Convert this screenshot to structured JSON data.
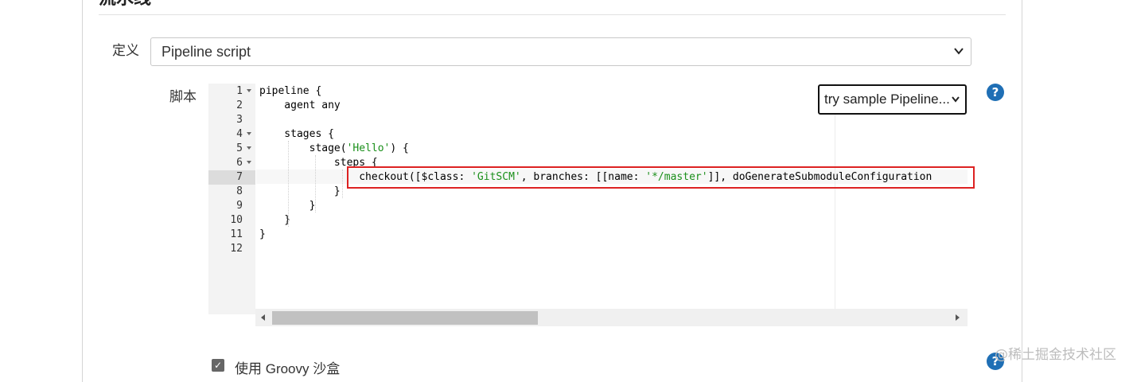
{
  "section": {
    "title": "流水线"
  },
  "definition": {
    "label": "定义",
    "selected": "Pipeline script"
  },
  "script": {
    "label": "脚本",
    "sample_select": "try sample Pipeline...",
    "line_numbers": [
      "1",
      "2",
      "3",
      "4",
      "5",
      "6",
      "7",
      "8",
      "9",
      "10",
      "11",
      "12"
    ],
    "lines": [
      [
        "pipeline {"
      ],
      [
        "    agent any"
      ],
      [
        ""
      ],
      [
        "    stages {"
      ],
      [
        "        stage(",
        "'Hello'",
        ") {"
      ],
      [
        "            steps {"
      ],
      [
        "                checkout([$class: ",
        "'GitSCM'",
        ", branches: [[name: ",
        "'*/master'",
        "]], doGenerateSubmoduleConfiguration"
      ],
      [
        "            }"
      ],
      [
        "        }"
      ],
      [
        "    }"
      ],
      [
        "}"
      ],
      [
        ""
      ]
    ]
  },
  "sandbox": {
    "label": "使用 Groovy 沙盒",
    "checked": true
  },
  "watermark": "@稀土掘金技术社区",
  "colors": {
    "help_icon": "#1f6fb5",
    "highlight_box": "#dd2222",
    "string_literal": "#1a8f1a"
  },
  "icons": {
    "help": "question-mark-icon",
    "dropdown": "chevron-down-icon",
    "checkbox": "check-icon"
  }
}
